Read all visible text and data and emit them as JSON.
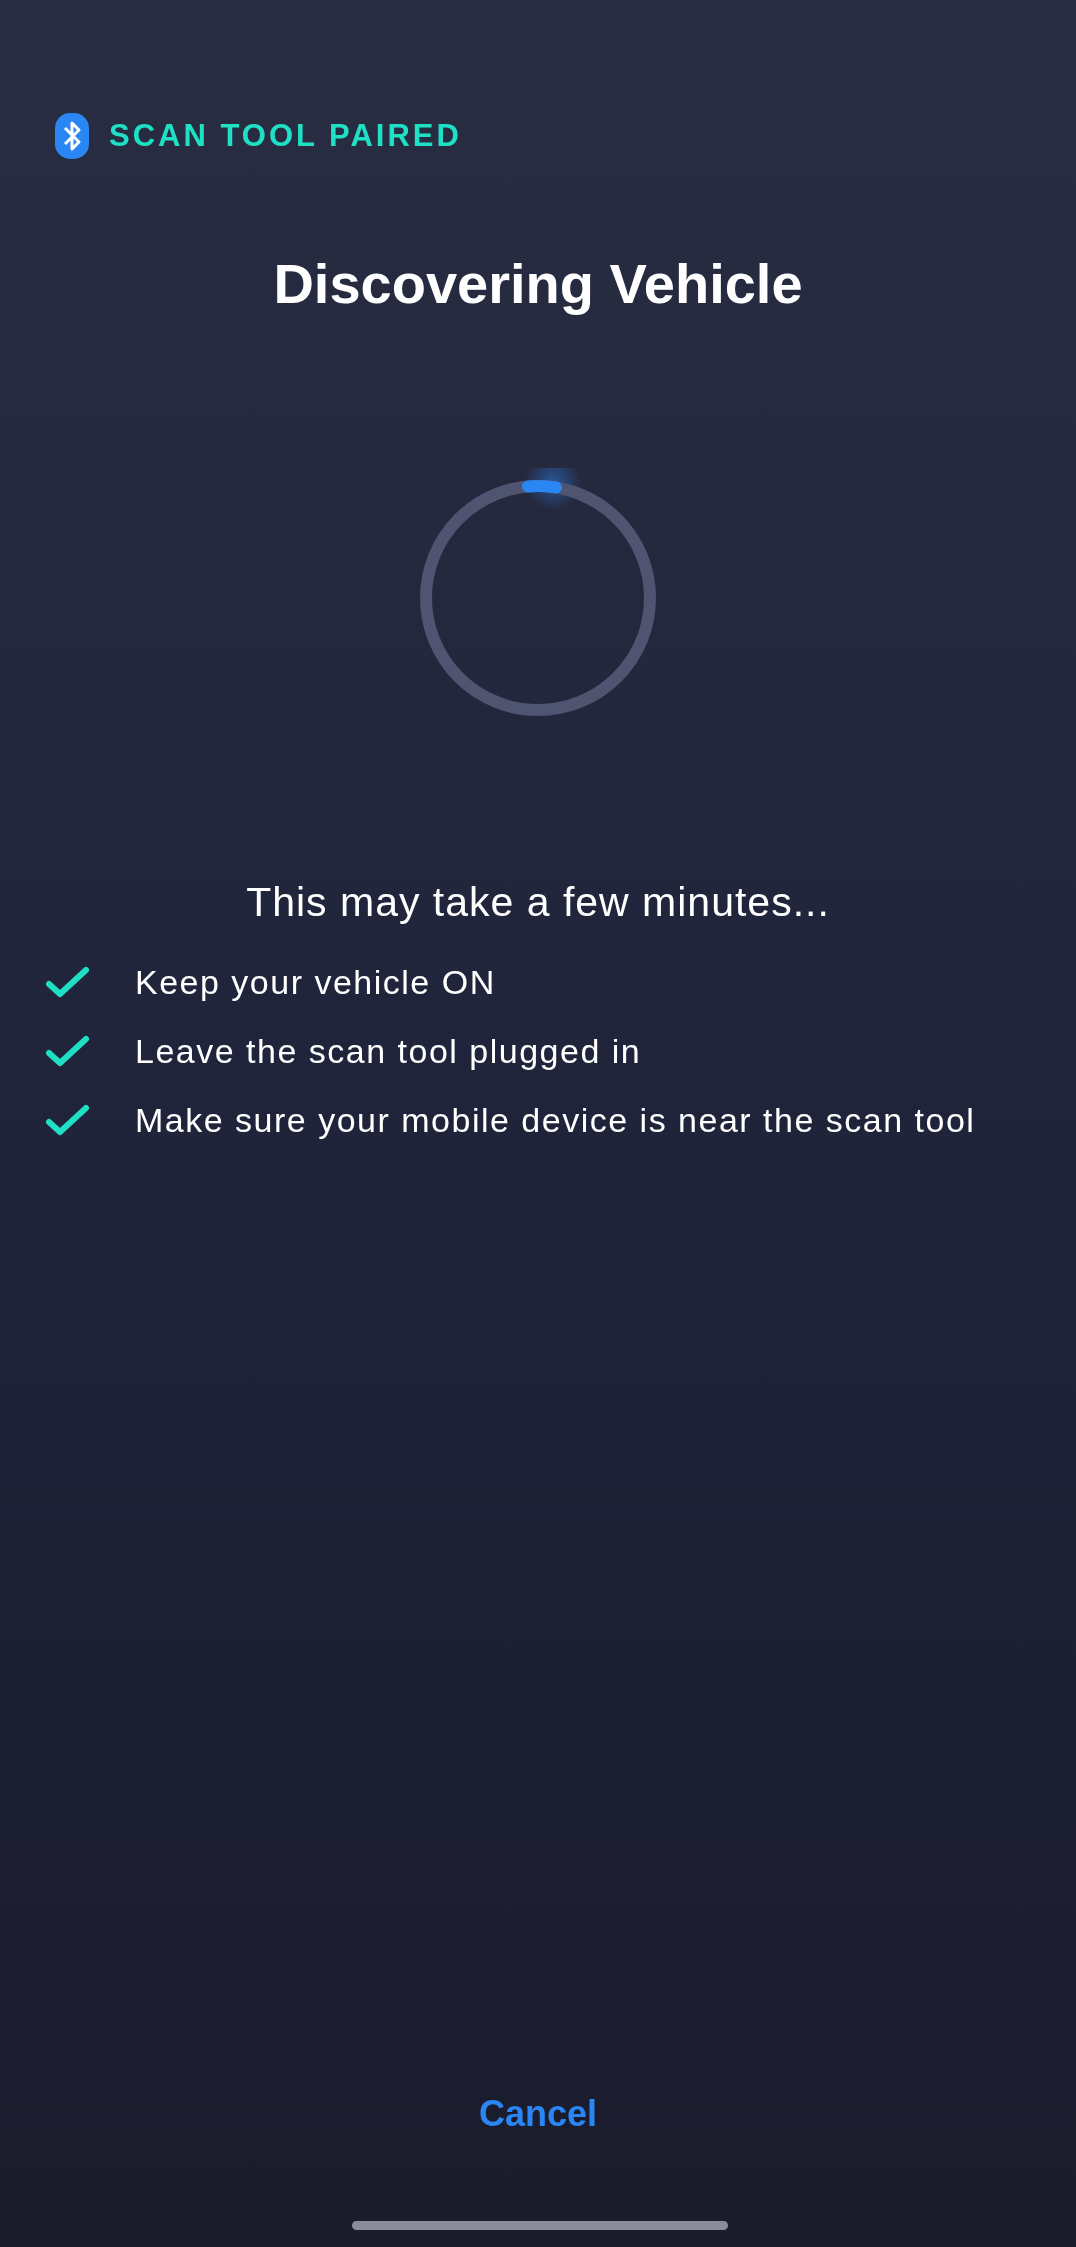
{
  "status_badge": {
    "label": "SCAN TOOL PAIRED"
  },
  "title": "Discovering Vehicle",
  "message": "This may take a few minutes...",
  "checklist": [
    {
      "label": "Keep your vehicle ON",
      "checked": true
    },
    {
      "label": "Leave the scan tool plugged in",
      "checked": true
    },
    {
      "label": "Make sure your mobile device is near the scan tool",
      "checked": true
    }
  ],
  "cancel_button": "Cancel"
}
